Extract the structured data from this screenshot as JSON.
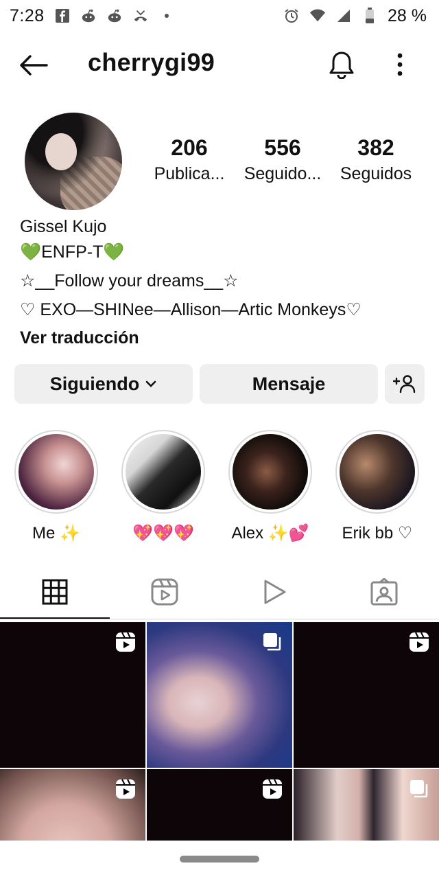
{
  "status_bar": {
    "time": "7:28",
    "battery_percent": "28 %",
    "icons": [
      "facebook-icon",
      "reddit-icon",
      "reddit-icon",
      "missed-call-icon",
      "dot-icon",
      "alarm-icon",
      "wifi-icon",
      "signal-icon",
      "battery-icon"
    ]
  },
  "header": {
    "username": "cherrygi99"
  },
  "profile": {
    "stats": [
      {
        "value": "206",
        "label": "Publica..."
      },
      {
        "value": "556",
        "label": "Seguido..."
      },
      {
        "value": "382",
        "label": "Seguidos"
      }
    ],
    "name": "Gissel Kujo",
    "bio_lines": [
      "💚ENFP-T💚",
      "☆__Follow your dreams__☆",
      "♡ EXO—SHINee—Allison—Artic Monkeys♡"
    ],
    "translate_label": "Ver traducción"
  },
  "actions": {
    "following_label": "Siguiendo",
    "message_label": "Mensaje"
  },
  "highlights": [
    {
      "label": "Me ✨"
    },
    {
      "label": "💖💖💖"
    },
    {
      "label": "Alex ✨💕"
    },
    {
      "label": "Erik bb ♡"
    }
  ],
  "tabs": [
    "grid-icon",
    "reels-icon",
    "video-icon",
    "tagged-icon"
  ],
  "grid": [
    {
      "type": "reel"
    },
    {
      "type": "carousel"
    },
    {
      "type": "reel"
    },
    {
      "type": "reel"
    },
    {
      "type": "reel"
    },
    {
      "type": "carousel"
    }
  ],
  "colors": {
    "button_bg": "#efefef",
    "text": "#111111",
    "divider": "#dbdbdb"
  }
}
